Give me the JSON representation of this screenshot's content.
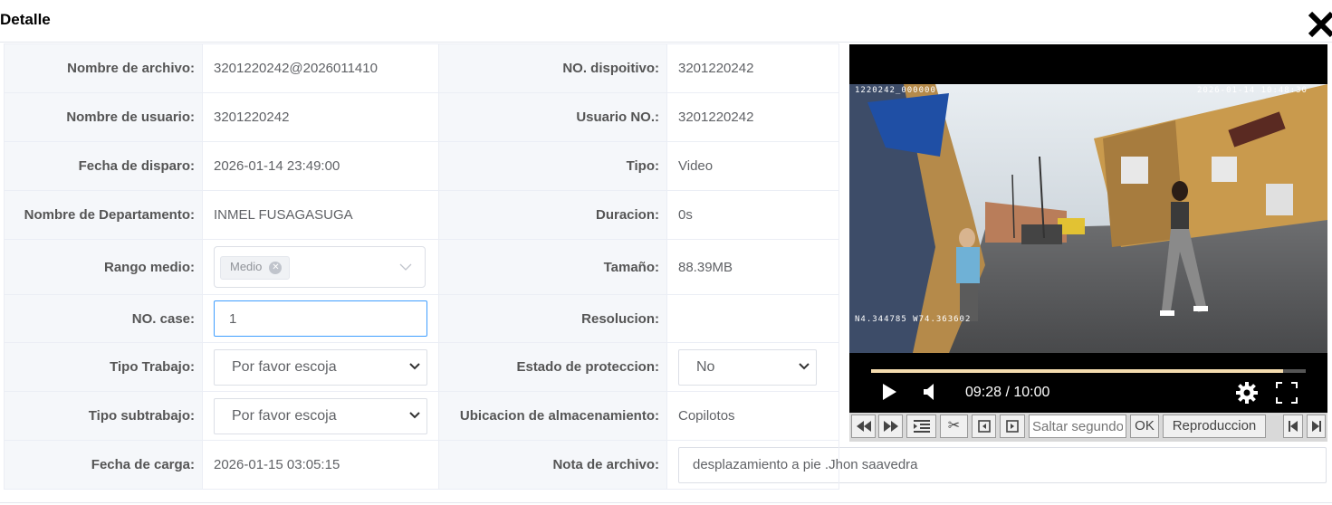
{
  "dialog": {
    "title": "Detalle"
  },
  "fields": {
    "nombre_archivo_label": "Nombre de archivo:",
    "nombre_archivo_value": "3201220242@2026011410",
    "no_dispositivo_label": "NO. dispoitivo:",
    "no_dispositivo_value": "3201220242",
    "nombre_usuario_label": "Nombre de usuario:",
    "nombre_usuario_value": "3201220242",
    "usuario_no_label": "Usuario NO.:",
    "usuario_no_value": "3201220242",
    "fecha_disparo_label": "Fecha de disparo:",
    "fecha_disparo_value": "2026-01-14 23:49:00",
    "tipo_label": "Tipo:",
    "tipo_value": "Video",
    "departamento_label": "Nombre de Departamento:",
    "departamento_value": "INMEL FUSAGASUGA",
    "duracion_label": "Duracion:",
    "duracion_value": "0s",
    "rango_label": "Rango medio:",
    "rango_tag": "Medio",
    "tamano_label": "Tamaño:",
    "tamano_value": "88.39MB",
    "case_label": "NO. case:",
    "case_value": "1",
    "resolucion_label": "Resolucion:",
    "resolucion_value": "",
    "tipo_trabajo_label": "Tipo Trabajo:",
    "tipo_trabajo_value": "Por favor escoja",
    "proteccion_label": "Estado de proteccion:",
    "proteccion_value": "No",
    "subtrabajo_label": "Tipo subtrabajo:",
    "subtrabajo_value": "Por favor escoja",
    "ubicacion_label": "Ubicacion de almacenamiento:",
    "ubicacion_value": "Copilotos",
    "fecha_carga_label": "Fecha de carga:",
    "fecha_carga_value": "2026-01-15 03:05:15",
    "nota_label": "Nota de archivo:",
    "nota_value": "desplazamiento a pie .Jhon saavedra"
  },
  "video": {
    "osd_id": "1220242_000000",
    "osd_datetime": "2026-01-14 10:48:30",
    "osd_gps": "N4.344785 W74.363602",
    "time": "09:28 / 10:00",
    "progress_fraction": 0.947
  },
  "toolbar": {
    "seek_placeholder": "Saltar segundos",
    "ok_label": "OK",
    "playback_label": "Reproduccion"
  },
  "icons": [
    "close-icon",
    "play-icon",
    "volume-icon",
    "settings-icon",
    "fullscreen-icon",
    "rewind-icon",
    "fast-forward-icon",
    "list-icon",
    "scissors-icon",
    "prev-frame-icon",
    "next-frame-icon",
    "skip-start-icon",
    "skip-end-icon",
    "chevron-down-icon"
  ]
}
